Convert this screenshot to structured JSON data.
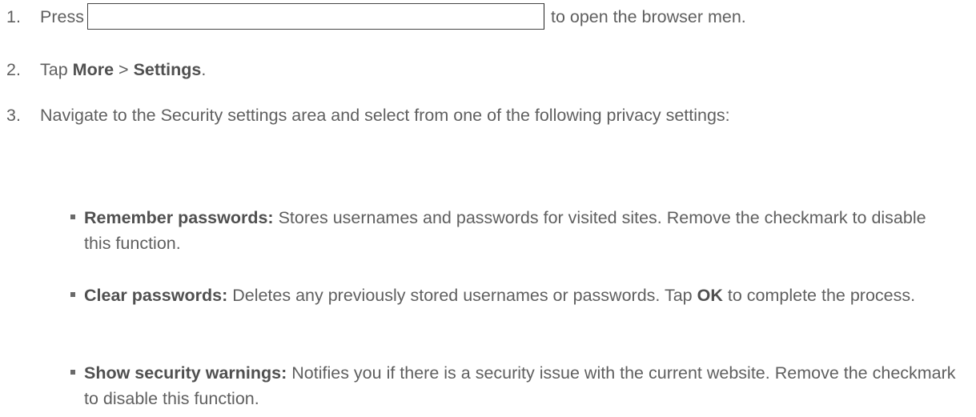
{
  "steps": [
    {
      "number": "1.",
      "prefix": "Press",
      "suffix": "to open the browser men."
    },
    {
      "number": "2.",
      "prefix": "Tap",
      "bold1": "More",
      "sep": ">",
      "bold2": "Settings",
      "end": "."
    },
    {
      "number": "3.",
      "text": "Navigate to the Security settings area and select from one of the following privacy settings:"
    }
  ],
  "bullets": [
    {
      "title": "Remember passwords:",
      "text": "Stores usernames and passwords for visited sites. Remove the checkmark to disable this function."
    },
    {
      "title": "Clear passwords:",
      "text": "Deletes any previously stored usernames or passwords. Tap",
      "bold": "OK",
      "text2": "to complete the process."
    },
    {
      "title": "Show security warnings:",
      "text": "Notifies you if there is a security issue with the current website. Remove the checkmark to disable this function."
    }
  ]
}
